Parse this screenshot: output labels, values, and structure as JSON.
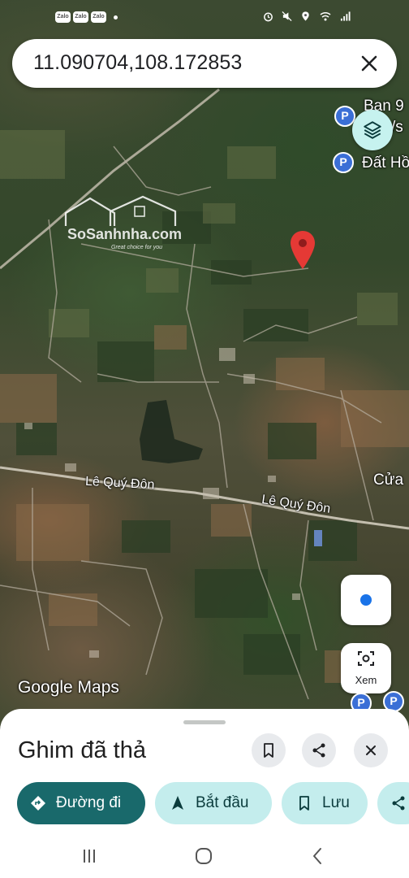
{
  "status_bar": {
    "apps": [
      "Zalo",
      "Zalo",
      "Zalo"
    ]
  },
  "search": {
    "query": "11.090704,108.172853"
  },
  "map": {
    "poi_labels": [
      "Ban 9",
      "Đất Hồ"
    ],
    "partial_label_1": "/s",
    "place_label": "Cửa",
    "road_name_1": "Lê Quý Đôn",
    "road_name_2": "Lê Quý Đôn",
    "watermark_title": "SoSanhnha.com",
    "watermark_sub": "Great choice for you",
    "google_logo": "Google Maps",
    "view_button_label": "Xem"
  },
  "sheet": {
    "title": "Ghim đã thả",
    "actions": [
      {
        "label": "Đường đi",
        "icon": "directions-icon"
      },
      {
        "label": "Bắt đầu",
        "icon": "navigation-arrow-icon"
      },
      {
        "label": "Lưu",
        "icon": "bookmark-icon"
      }
    ]
  },
  "colors": {
    "primary": "#19696b",
    "secondary": "#c4eded",
    "pin_red": "#e53935",
    "poi_blue": "#3b6fd6",
    "location_blue": "#1a73e8"
  }
}
